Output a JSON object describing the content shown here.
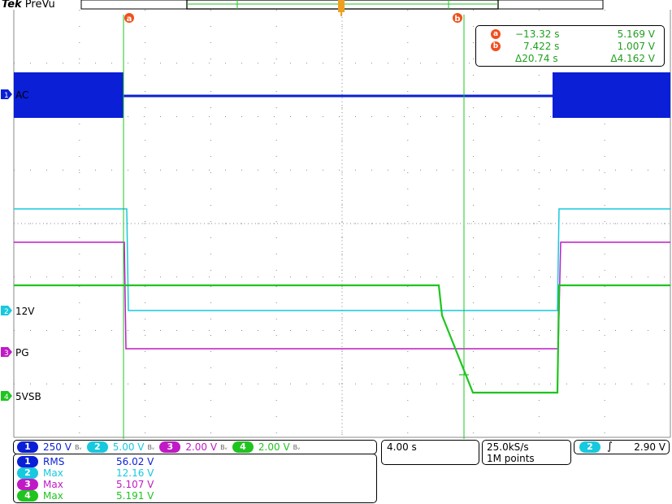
{
  "header": {
    "brand": "Tek",
    "mode": "PreVu"
  },
  "cursors": {
    "a": {
      "label": "a",
      "time": "−13.32 s",
      "value": "5.169 V"
    },
    "b": {
      "label": "b",
      "time": "7.422 s",
      "value": "1.007 V"
    },
    "delta": {
      "time": "Δ20.74 s",
      "value": "Δ4.162 V"
    }
  },
  "channels": [
    {
      "num": "1",
      "label": "AC",
      "scale": "250 V",
      "color": "#0a1fd6"
    },
    {
      "num": "2",
      "label": "12V",
      "scale": "5.00 V",
      "color": "#17c9de"
    },
    {
      "num": "3",
      "label": "PG",
      "scale": "2.00 V",
      "color": "#c01ac6"
    },
    {
      "num": "4",
      "label": "5VSB",
      "scale": "2.00 V",
      "color": "#1fc41f"
    }
  ],
  "bw_mark": "Bᵥ",
  "timebase": "4.00 s",
  "sample_rate": "25.0kS/s",
  "record_length": "1M points",
  "trigger": {
    "channel": "2",
    "slope_icon": "rising-edge-icon",
    "level": "2.90 V"
  },
  "measurements": [
    {
      "ch": "1",
      "name": "RMS",
      "value": "56.02 V",
      "color": "#0a1fd6"
    },
    {
      "ch": "2",
      "name": "Max",
      "value": "12.16 V",
      "color": "#17c9de"
    },
    {
      "ch": "3",
      "name": "Max",
      "value": "5.107 V",
      "color": "#c01ac6"
    },
    {
      "ch": "4",
      "name": "Max",
      "value": "5.191 V",
      "color": "#1fc41f"
    }
  ],
  "colors": {
    "cursor": "#1fc41f",
    "cursor_badge": "#f0501e",
    "graticule": "#888888"
  }
}
